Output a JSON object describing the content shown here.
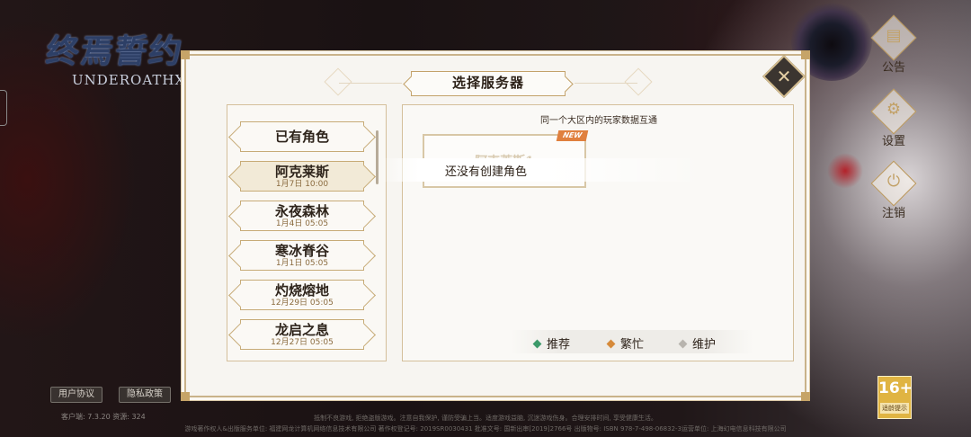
{
  "logo": {
    "title": "终焉誓约",
    "subtitle": "UNDEROATHX"
  },
  "side_buttons": [
    {
      "label": "公告",
      "icon": "announcement-icon"
    },
    {
      "label": "设置",
      "icon": "gear-icon"
    },
    {
      "label": "注销",
      "icon": "power-icon"
    }
  ],
  "dialog": {
    "title": "选择服务器",
    "interop_note": "同一个大区内的玩家数据互通",
    "server_list": [
      {
        "name": "已有角色",
        "time": ""
      },
      {
        "name": "阿克莱斯",
        "time": "1月7日 10:00"
      },
      {
        "name": "永夜森林",
        "time": "1月4日 05:05"
      },
      {
        "name": "寒冰脊谷",
        "time": "1月1日 05:05"
      },
      {
        "name": "灼烧熔地",
        "time": "12月29日 05:05"
      },
      {
        "name": "龙启之息",
        "time": "12月27日 05:05"
      }
    ],
    "selected_index": 1,
    "server_card": {
      "name": "阿克莱斯1",
      "badge": "NEW"
    },
    "toast": "还没有创建角色",
    "legend": [
      {
        "label": "推荐",
        "color": "#3c9a6a"
      },
      {
        "label": "繁忙",
        "color": "#d68a3a"
      },
      {
        "label": "维护",
        "color": "#b8b4ae"
      }
    ]
  },
  "footer": {
    "user_agreement": "用户协议",
    "privacy_policy": "隐私政策",
    "version": "客户端: 7.3.20  资源: 324",
    "notice": "抵制不良游戏, 拒绝盗版游戏。注意自我保护, 谨防受骗上当。适度游戏益脑, 沉迷游戏伤身。合理安排时间, 享受健康生活。",
    "license": "游戏著作权人&出版服务单位: 福建网龙计算机网络信息技术有限公司  著作权登记号: 2019SR0030431  批准文号: 国新出审[2019]2766号  出版物号: ISBN 978-7-498-06832-3运营单位: 上海幻电信息科技有限公司",
    "age_rating": "16+",
    "age_rating_label": "适龄提示"
  }
}
